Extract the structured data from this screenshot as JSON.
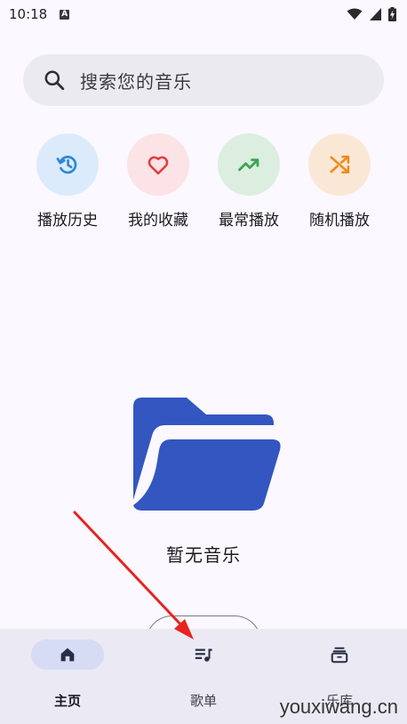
{
  "status_bar": {
    "time": "10:18",
    "badge": "A",
    "icons": [
      "wifi-icon",
      "signal-icon",
      "battery-charging-icon"
    ]
  },
  "search": {
    "placeholder": "搜索您的音乐",
    "icon": "search-icon"
  },
  "quick_actions": [
    {
      "label": "播放历史",
      "icon": "history-icon",
      "bg": "#dcebfb",
      "color": "#2b88d8"
    },
    {
      "label": "我的收藏",
      "icon": "heart-icon",
      "bg": "#fbe3e6",
      "color": "#e0403f"
    },
    {
      "label": "最常播放",
      "icon": "trending-up-icon",
      "bg": "#dceedf",
      "color": "#3aa554"
    },
    {
      "label": "随机播放",
      "icon": "shuffle-icon",
      "bg": "#fbe7d6",
      "color": "#ee8a1c"
    }
  ],
  "empty_state": {
    "icon": "folder-open-icon",
    "color": "#3356c0",
    "message": "暂无音乐"
  },
  "bottom_nav": [
    {
      "label": "主页",
      "icon": "home-icon",
      "active": true
    },
    {
      "label": "歌单",
      "icon": "playlist-icon",
      "active": false
    },
    {
      "label": "乐库",
      "icon": "library-icon",
      "active": false
    }
  ],
  "annotation": {
    "color": "#e8231e"
  },
  "watermark": "youxiwang.cn"
}
